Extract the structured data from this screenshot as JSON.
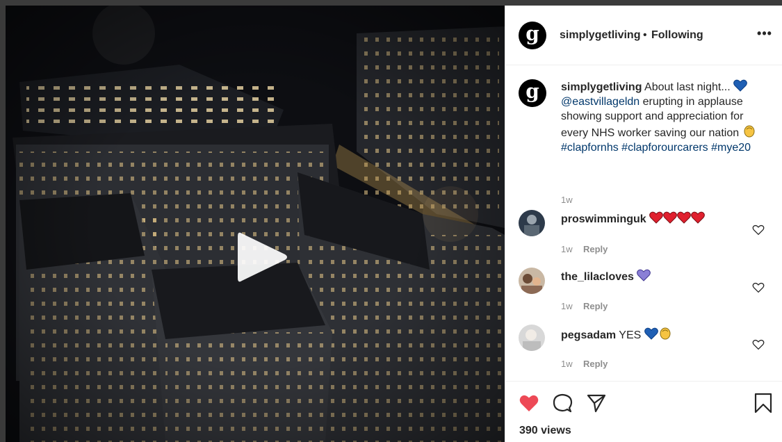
{
  "post": {
    "account_initial": "g",
    "username": "simplygetliving",
    "separator": "•",
    "follow_status": "Following",
    "more_label": "•••"
  },
  "caption": {
    "username": "simplygetliving",
    "text_part1": "About last night... ",
    "mention": "@eastvillageldn",
    "text_part2": " erupting in applause showing support and appreciation for every NHS worker saving our nation ",
    "hashtag1": "#clapfornhs",
    "hashtag2": "#clapforourcarers",
    "hashtag3": "#mye20",
    "time": "1w"
  },
  "comments": [
    {
      "username": "proswimminguk",
      "text": "",
      "emojis": "red-heart x4",
      "time": "1w",
      "reply_label": "Reply"
    },
    {
      "username": "the_lilacloves",
      "text": "",
      "emojis": "purple-heart",
      "time": "1w",
      "reply_label": "Reply"
    },
    {
      "username": "pegsadam",
      "text": "YES",
      "emojis": "blue-heart clapping-hands",
      "time": "1w",
      "reply_label": "Reply"
    }
  ],
  "stats": {
    "views": "390 views"
  },
  "colors": {
    "heart_red": "#ed4956",
    "link_blue": "#00376b",
    "muted": "#8e8e8e",
    "blue_heart": "#1f5fb4",
    "purple_heart": "#8a7fd6",
    "clap_yellow": "#f6c443"
  }
}
